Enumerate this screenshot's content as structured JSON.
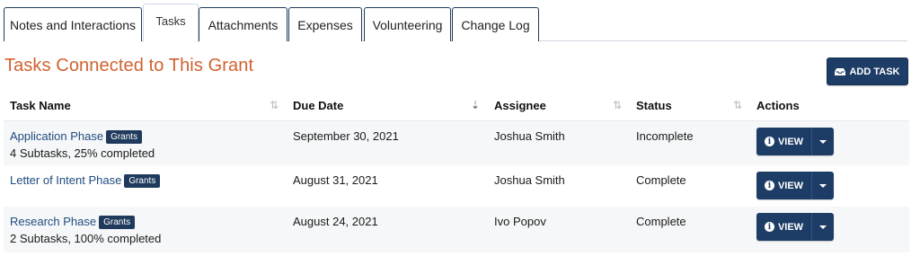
{
  "tabs": [
    {
      "label": "Notes and Interactions",
      "active": false
    },
    {
      "label": "Tasks",
      "active": true
    },
    {
      "label": "Attachments",
      "active": false
    },
    {
      "label": "Expenses",
      "active": false
    },
    {
      "label": "Volunteering",
      "active": false
    },
    {
      "label": "Change Log",
      "active": false
    }
  ],
  "section": {
    "title": "Tasks Connected to This Grant",
    "add_task_label": "ADD TASK",
    "add_task_icon": "inbox-icon"
  },
  "table": {
    "columns": [
      {
        "label": "Task Name",
        "sort": "sortable"
      },
      {
        "label": "Due Date",
        "sort": "sorted-desc"
      },
      {
        "label": "Assignee",
        "sort": "sortable"
      },
      {
        "label": "Status",
        "sort": "sortable"
      },
      {
        "label": "Actions",
        "sort": "none"
      }
    ],
    "rows": [
      {
        "task_name": "Application Phase",
        "badge": "Grants",
        "subtext": "4 Subtasks, 25% completed",
        "due_date": "September 30, 2021",
        "assignee": "Joshua Smith",
        "status": "Incomplete",
        "view_label": "VIEW"
      },
      {
        "task_name": "Letter of Intent Phase",
        "badge": "Grants",
        "subtext": "",
        "due_date": "August 31, 2021",
        "assignee": "Joshua Smith",
        "status": "Complete",
        "view_label": "VIEW"
      },
      {
        "task_name": "Research Phase",
        "badge": "Grants",
        "subtext": "2 Subtasks, 100% completed",
        "due_date": "August 24, 2021",
        "assignee": "Ivo Popov",
        "status": "Complete",
        "view_label": "VIEW"
      }
    ]
  },
  "colors": {
    "title_orange": "#d0612f",
    "navy": "#1e3d66",
    "link_blue": "#1f4b80"
  }
}
